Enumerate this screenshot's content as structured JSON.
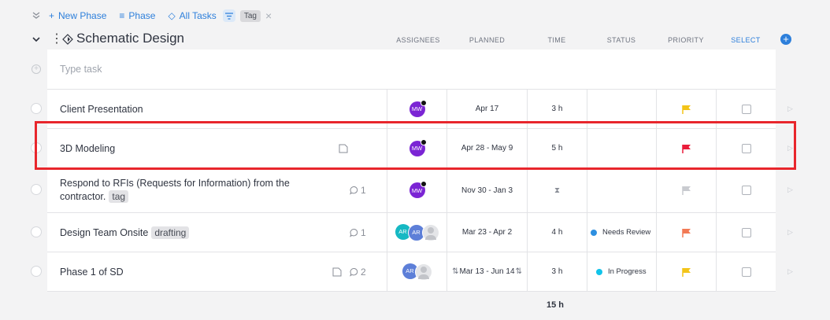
{
  "toolbar": {
    "new_phase": "New Phase",
    "phase": "Phase",
    "all_tasks": "All Tasks",
    "tag_chip": "Tag"
  },
  "phase": {
    "title": "Schematic Design"
  },
  "columns": {
    "assignees": "ASSIGNEES",
    "planned": "PLANNED",
    "time": "TIME",
    "status": "STATUS",
    "priority": "PRIORITY",
    "select": "SELECT"
  },
  "new_task": {
    "placeholder": "Type task"
  },
  "colors": {
    "accent": "#2d7fdb",
    "avatar_mw": "#7b25d4",
    "avatar_ar_teal": "#16b8c3",
    "avatar_ar_blue": "#5d7fd8",
    "flag_yellow": "#f3c418",
    "flag_red": "#ea1c3a",
    "flag_gray": "#c9cbd0",
    "flag_orange": "#f27a55",
    "status_blue": "#2d8fe0",
    "status_cyan": "#11c4ea",
    "highlight": "#e8262c"
  },
  "tasks": [
    {
      "name": "Client Presentation",
      "avatar": "MW",
      "planned": "Apr 17",
      "time": "3 h",
      "status": "",
      "priority": "yellow"
    },
    {
      "name": "3D Modeling",
      "avatar": "MW",
      "planned": "Apr 28 - May 9",
      "time": "5 h",
      "status": "",
      "priority": "red"
    },
    {
      "name_line1": "Respond to RFIs (Requests for Information) from the",
      "name_line2": "contractor.",
      "tag": "tag",
      "comments": "1",
      "avatar": "MW",
      "planned": "Nov 30 - Jan 3",
      "time": "⧗",
      "status": "",
      "priority": "gray"
    },
    {
      "name": "Design Team Onsite",
      "tag": "drafting",
      "comments": "1",
      "avatars": [
        "AR",
        "AR"
      ],
      "planned": "Mar 23 - Apr 2",
      "time": "4 h",
      "status": "Needs Review",
      "priority": "orange"
    },
    {
      "name": "Phase 1 of SD",
      "comments": "2",
      "avatars": [
        "AR"
      ],
      "planned": "Mar 13 - Jun 14",
      "time": "3 h",
      "status": "In Progress",
      "priority": "yellow"
    }
  ],
  "total_time": "15 h"
}
